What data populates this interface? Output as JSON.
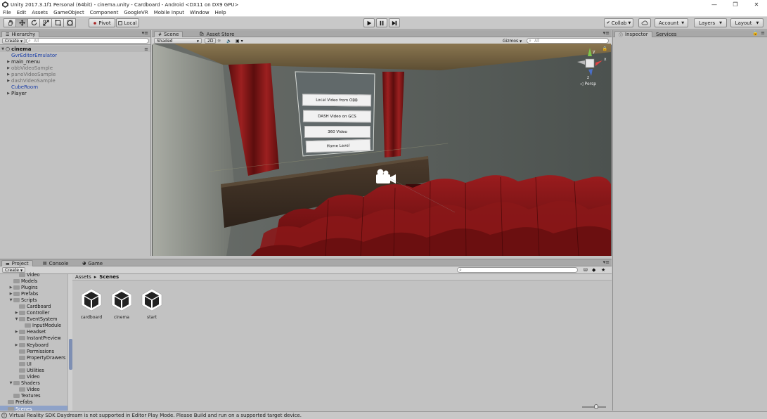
{
  "window": {
    "title": "Unity 2017.3.1f1 Personal (64bit) - cinema.unity - Cardboard - Android <DX11 on DX9 GPU>",
    "controls": [
      "minimize",
      "restore",
      "close"
    ]
  },
  "menu": [
    "File",
    "Edit",
    "Assets",
    "GameObject",
    "Component",
    "GoogleVR",
    "Mobile Input",
    "Window",
    "Help"
  ],
  "toolbar": {
    "tools": [
      "hand-tool",
      "move-tool",
      "rotate-tool",
      "scale-tool",
      "rect-tool",
      "transform-tool"
    ],
    "pivot_label": "Pivot",
    "local_label": "Local",
    "collab_label": "Collab",
    "account_label": "Account",
    "layers_label": "Layers",
    "layout_label": "Layout"
  },
  "hierarchy": {
    "tab": "Hierarchy",
    "create_label": "Create",
    "search_placeholder": "All",
    "scene_name": "cinema",
    "items": [
      {
        "label": "GvrEditorEmulator",
        "style": "blue",
        "expandable": false
      },
      {
        "label": "main_menu",
        "style": "normal",
        "expandable": true
      },
      {
        "label": "obbVideoSample",
        "style": "gray",
        "expandable": true
      },
      {
        "label": "panoVideoSample",
        "style": "gray",
        "expandable": true
      },
      {
        "label": "dashVideoSample",
        "style": "gray",
        "expandable": true
      },
      {
        "label": "CubeRoom",
        "style": "blue",
        "expandable": false
      },
      {
        "label": "Player",
        "style": "normal",
        "expandable": true
      }
    ]
  },
  "scene": {
    "tabs": [
      "Scene",
      "Asset Store"
    ],
    "shading_label": "Shaded",
    "mode_2d_label": "2D",
    "gizmos_label": "Gizmos",
    "search_placeholder": "All",
    "persp_label": "Persp",
    "menu_buttons": [
      "Local Video from OBB",
      "DASH Video on GCS",
      "360 Video",
      "Home Level"
    ]
  },
  "inspector": {
    "tabs": [
      "Inspector",
      "Services"
    ]
  },
  "project": {
    "tabs": [
      "Project",
      "Console",
      "Game"
    ],
    "create_label": "Create",
    "tree": [
      {
        "label": "Video",
        "indent": 2,
        "arrow": "none"
      },
      {
        "label": "Models",
        "indent": 1,
        "arrow": "none"
      },
      {
        "label": "Plugins",
        "indent": 1,
        "arrow": "collapsed"
      },
      {
        "label": "Prefabs",
        "indent": 1,
        "arrow": "collapsed"
      },
      {
        "label": "Scripts",
        "indent": 1,
        "arrow": "expanded"
      },
      {
        "label": "Cardboard",
        "indent": 2,
        "arrow": "none"
      },
      {
        "label": "Controller",
        "indent": 2,
        "arrow": "collapsed"
      },
      {
        "label": "EventSystem",
        "indent": 2,
        "arrow": "expanded"
      },
      {
        "label": "InputModule",
        "indent": 3,
        "arrow": "none"
      },
      {
        "label": "Headset",
        "indent": 2,
        "arrow": "collapsed"
      },
      {
        "label": "InstantPreview",
        "indent": 2,
        "arrow": "none"
      },
      {
        "label": "Keyboard",
        "indent": 2,
        "arrow": "collapsed"
      },
      {
        "label": "Permissions",
        "indent": 2,
        "arrow": "none"
      },
      {
        "label": "PropertyDrawers",
        "indent": 2,
        "arrow": "none"
      },
      {
        "label": "UI",
        "indent": 2,
        "arrow": "none"
      },
      {
        "label": "Utilities",
        "indent": 2,
        "arrow": "none"
      },
      {
        "label": "Video",
        "indent": 2,
        "arrow": "none"
      },
      {
        "label": "Shaders",
        "indent": 1,
        "arrow": "expanded"
      },
      {
        "label": "Video",
        "indent": 2,
        "arrow": "none"
      },
      {
        "label": "Textures",
        "indent": 1,
        "arrow": "none"
      },
      {
        "label": "Prefabs",
        "indent": 0,
        "arrow": "none"
      },
      {
        "label": "Scenes",
        "indent": 0,
        "arrow": "none",
        "selected": true
      }
    ],
    "breadcrumb": {
      "root": "Assets",
      "separator": "▸",
      "current": "Scenes"
    },
    "assets": [
      "cardboard",
      "cinema",
      "start"
    ]
  },
  "status": {
    "message": "Virtual Reality SDK Daydream is not supported in Editor Play Mode. Please Build and run on a supported target device."
  },
  "colors": {
    "selection_blue": "#8ea2c8",
    "prefab_blue": "#1b3fa8",
    "curtain_red": "#8b1a1a",
    "seat_red": "#7e1416"
  }
}
